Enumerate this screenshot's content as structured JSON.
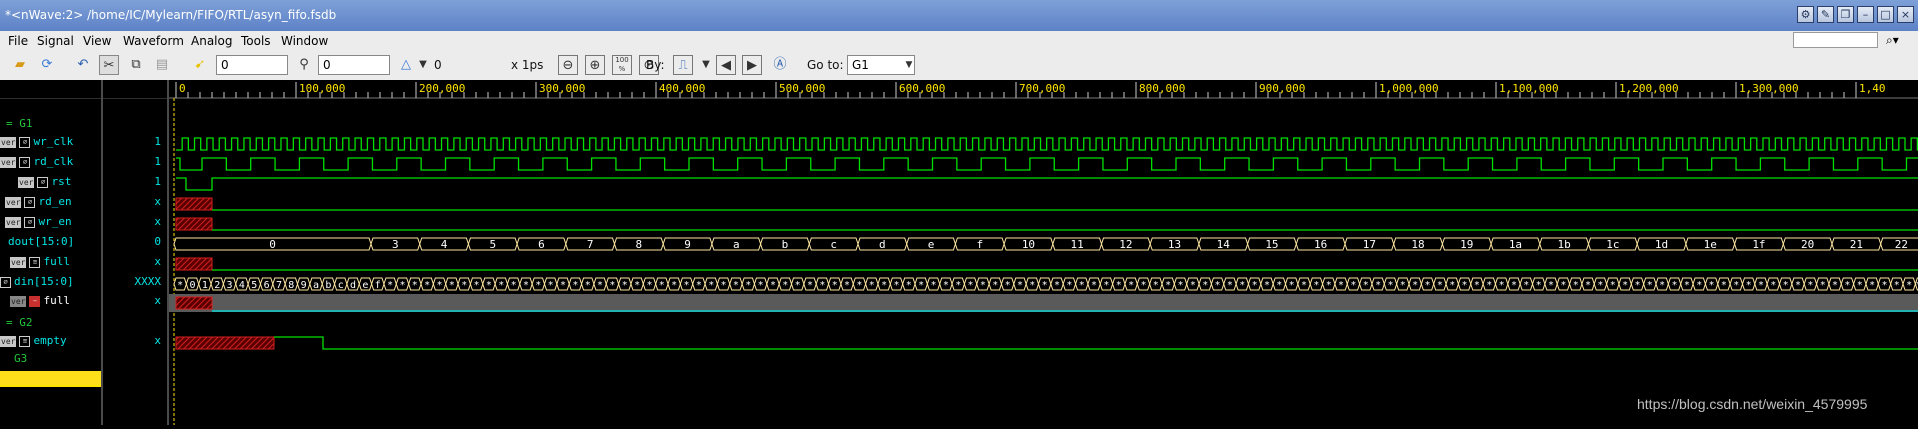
{
  "window": {
    "title": "*<nWave:2> /home/IC/Mylearn/FIFO/RTL/asyn_fifo.fsdb"
  },
  "menu": {
    "items": [
      {
        "label": "File"
      },
      {
        "label": "Signal"
      },
      {
        "label": "View"
      },
      {
        "label": "Waveform"
      },
      {
        "label": "Analog"
      },
      {
        "label": "Tools"
      },
      {
        "label": "Window"
      }
    ]
  },
  "toolbar": {
    "cursor_time": "0",
    "marker_time": "0",
    "delta": "0",
    "unit": "x 1ps",
    "zoom_full_label": "100 %",
    "by_label": "By:",
    "goto_label": "Go to:",
    "goto_value": "G1"
  },
  "groups": [
    {
      "name": "G1"
    },
    {
      "name": "G2"
    },
    {
      "name": "G3"
    }
  ],
  "signals": [
    {
      "name": "wr_clk",
      "tag": "ver",
      "value": "1"
    },
    {
      "name": "rd_clk",
      "tag": "ver",
      "value": "1"
    },
    {
      "name": "rst",
      "tag": "ver",
      "value": "1"
    },
    {
      "name": "rd_en",
      "tag": "ver",
      "value": "x"
    },
    {
      "name": "wr_en",
      "tag": "ver",
      "value": "x"
    },
    {
      "name": "dout[15:0]",
      "tag": "",
      "value": "0"
    },
    {
      "name": "full",
      "tag": "ver",
      "value": "x"
    },
    {
      "name": "din[15:0]",
      "tag": "",
      "value": "XXXX"
    },
    {
      "name": "full",
      "tag": "ver",
      "value": "x"
    },
    {
      "name": "empty",
      "tag": "ver",
      "value": "x"
    }
  ],
  "timeline": {
    "ticks": [
      "0",
      "100,000",
      "200,000",
      "300,000",
      "400,000",
      "500,000",
      "600,000",
      "700,000",
      "800,000",
      "900,000",
      "1,000,000",
      "1,100,000",
      "1,200,000",
      "1,300,000",
      "1,40"
    ]
  },
  "dout_values": [
    "0",
    "3",
    "4",
    "5",
    "6",
    "7",
    "8",
    "9",
    "a",
    "b",
    "c",
    "d",
    "e",
    "f",
    "10",
    "11",
    "12",
    "13",
    "14",
    "15",
    "16",
    "17",
    "18",
    "19",
    "1a",
    "1b",
    "1c",
    "1d",
    "1e",
    "1f",
    "20",
    "21",
    "22"
  ],
  "din_values": [
    "0",
    "1",
    "2",
    "3",
    "4",
    "5",
    "6",
    "7",
    "8",
    "9",
    "a",
    "b",
    "c",
    "d",
    "e",
    "f"
  ],
  "colors": {
    "wave": "#00e000",
    "bus": "#ffe6a0",
    "unknown": "#d42020",
    "signal_text": "#00e6e6",
    "group_text": "#22c83a",
    "cursor": "#ffe400"
  },
  "watermark": "https://blog.csdn.net/weixin_4579995"
}
